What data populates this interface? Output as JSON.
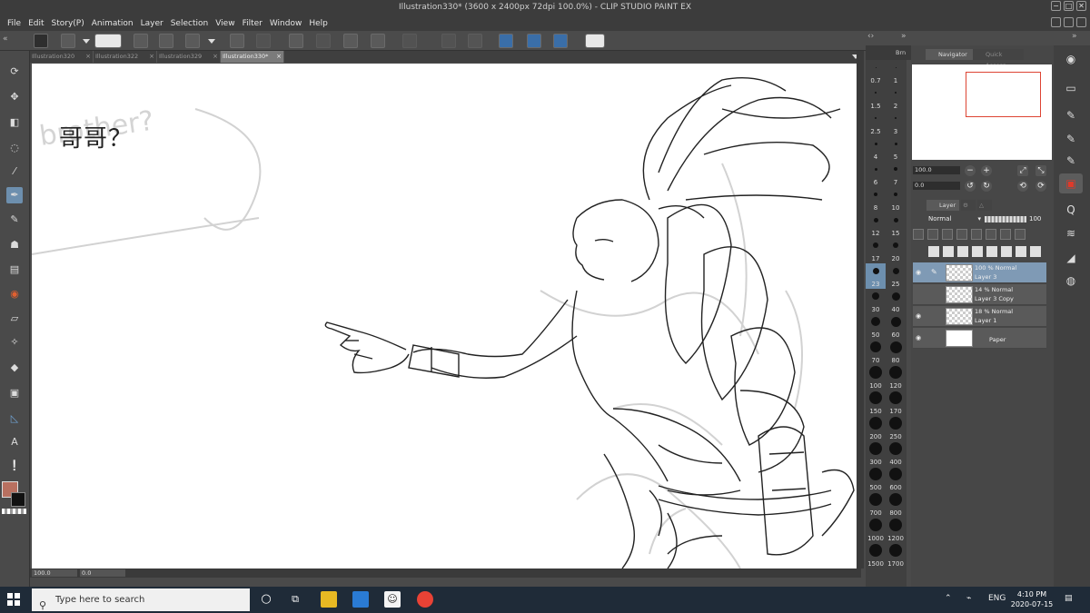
{
  "window": {
    "title": "Illustration330* (3600 x 2400px 72dpi 100.0%)  - CLIP STUDIO PAINT EX",
    "minimize": "−",
    "restore": "□",
    "close": "✕"
  },
  "menu": [
    "File",
    "Edit",
    "Story(P)",
    "Animation",
    "Layer",
    "Selection",
    "View",
    "Filter",
    "Window",
    "Help"
  ],
  "tabs": [
    {
      "label": "Illustration320",
      "active": false
    },
    {
      "label": "Illustration322",
      "active": false
    },
    {
      "label": "Illustration329",
      "active": false
    },
    {
      "label": "Illustration330*",
      "active": true
    }
  ],
  "tab_close": "×",
  "canvas": {
    "overlay_text": "哥哥？",
    "sketch_text": "brother?"
  },
  "statusbar": {
    "zoom": "100.0",
    "angle": "0.0"
  },
  "brush_panel": {
    "header": "Brn",
    "sizes": [
      "0.7",
      "1",
      "1.5",
      "2",
      "2.5",
      "3",
      "4",
      "5",
      "6",
      "7",
      "8",
      "10",
      "12",
      "15",
      "17",
      "20",
      "23",
      "25",
      "30",
      "40",
      "50",
      "60",
      "70",
      "80",
      "100",
      "120",
      "150",
      "170",
      "200",
      "250",
      "300",
      "400",
      "500",
      "600",
      "700",
      "800",
      "1000",
      "1200",
      "1500",
      "1700"
    ],
    "selected": "23"
  },
  "navigator": {
    "tab_navigator": "Navigator",
    "tab_quick_access": "Quick Access",
    "zoom": "100.0",
    "angle": "0.0"
  },
  "layer_panel": {
    "tab_label": "Layer",
    "blend_mode": "Normal",
    "opacity": "100",
    "layers": [
      {
        "line1": "100 % Normal",
        "line2": "Layer 3",
        "selected": true,
        "visible": true,
        "paper": false
      },
      {
        "line1": "14 % Normal",
        "line2": "Layer 3 Copy",
        "selected": false,
        "visible": false,
        "paper": false
      },
      {
        "line1": "18 % Normal",
        "line2": "Layer 1",
        "selected": false,
        "visible": true,
        "paper": false
      },
      {
        "line1": "",
        "line2": "Paper",
        "selected": false,
        "visible": true,
        "paper": true
      }
    ]
  },
  "taskbar": {
    "search_placeholder": "Type here to search",
    "language": "ENG",
    "time": "4:10 PM",
    "date": "2020-07-15"
  },
  "colors": {
    "main_color": "#b87060",
    "sub_color": "#111111",
    "selection_highlight": "#6d8fae"
  }
}
